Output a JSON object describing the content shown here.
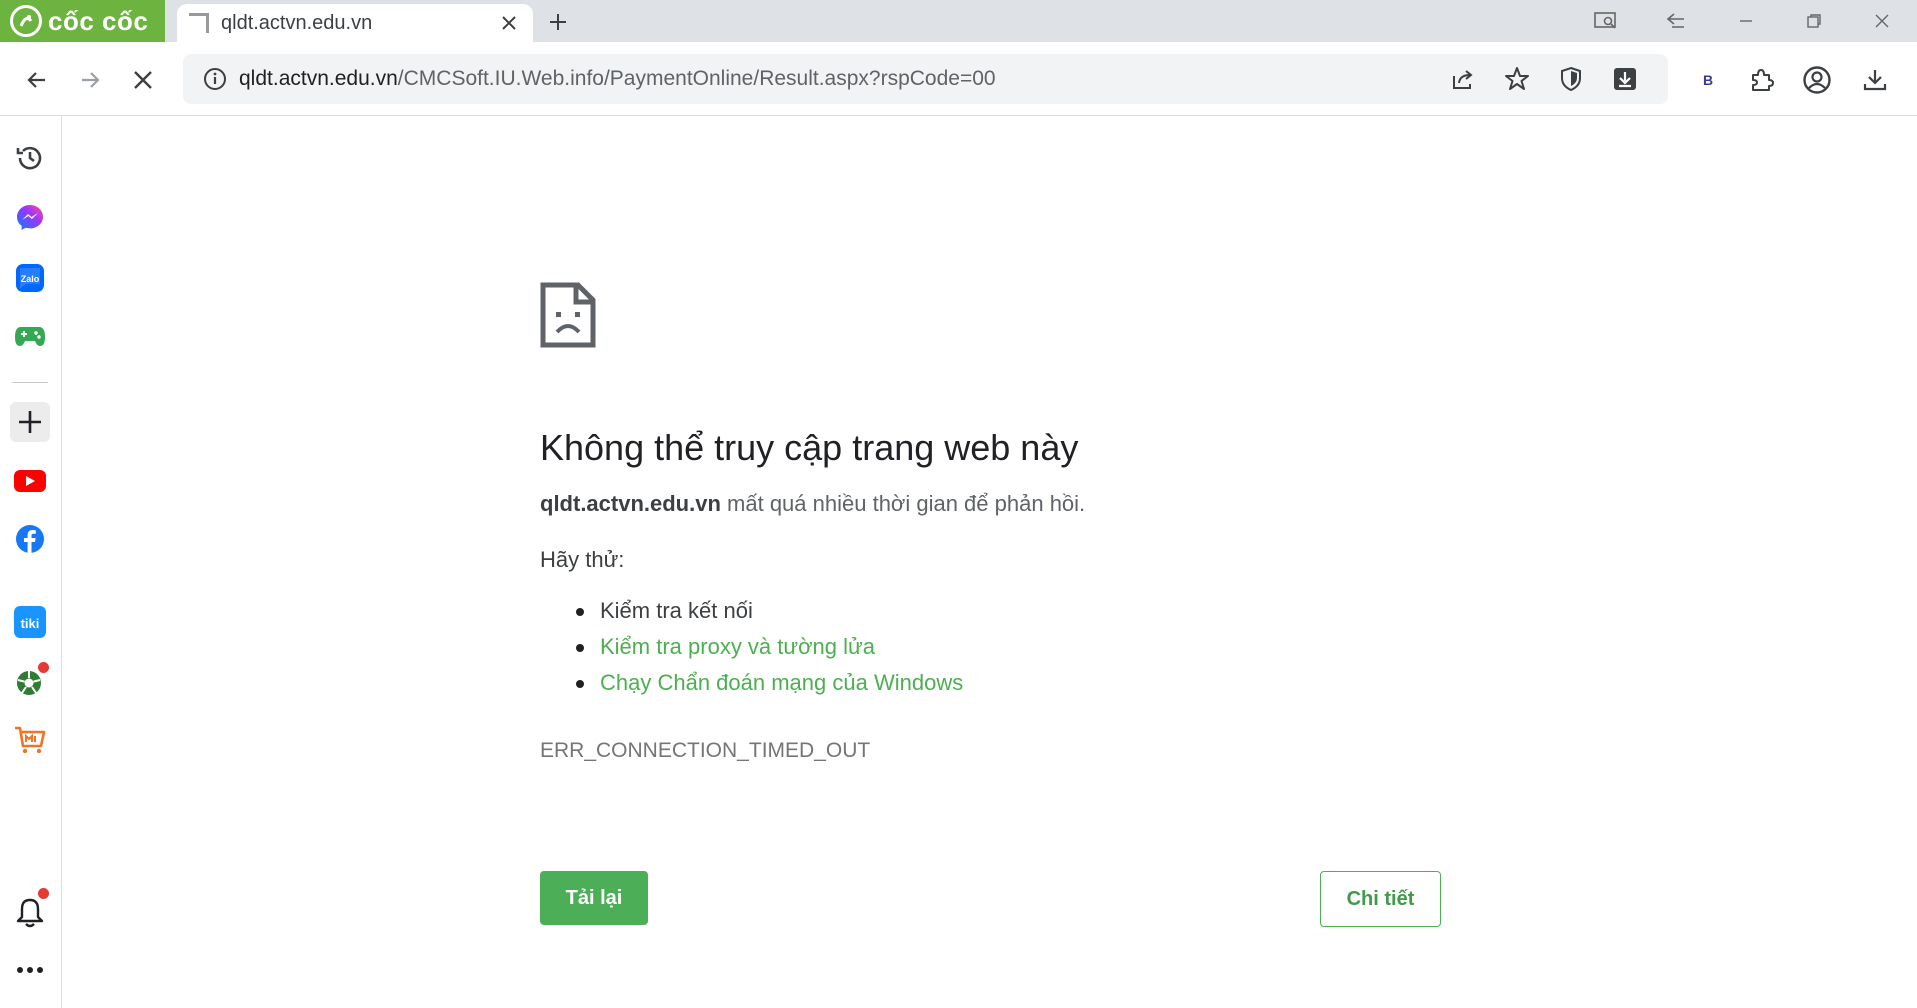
{
  "brand": {
    "name": "cốc cốc",
    "color": "#6db33f"
  },
  "tab": {
    "title": "qldt.actvn.edu.vn"
  },
  "address_bar": {
    "host": "qldt.actvn.edu.vn",
    "path": "/CMCSoft.IU.Web.info/PaymentOnline/Result.aspx?rspCode=00"
  },
  "toolbar": {
    "icons": [
      "back-icon",
      "forward-icon",
      "stop-icon",
      "info-icon",
      "share-icon",
      "star-icon",
      "shield-icon",
      "download-arrow-icon",
      "extension-b",
      "puzzle-icon",
      "profile-icon",
      "downloads-icon"
    ],
    "extension_letter": "B"
  },
  "window_controls": [
    "screen-capture-icon",
    "back-history-icon",
    "minimize-icon",
    "restore-icon",
    "close-icon"
  ],
  "sidebar": {
    "items": [
      "history-icon",
      "messenger-icon",
      "zalo-icon",
      "games-icon",
      "add-icon",
      "youtube-icon",
      "facebook-icon",
      "tiki-icon",
      "football-icon",
      "shopping-icon",
      "bell-icon",
      "more-icon"
    ],
    "zalo_label": "Zalo",
    "tiki_label": "tiki"
  },
  "error": {
    "title": "Không thể truy cập trang web này",
    "host": "qldt.actvn.edu.vn",
    "message": " mất quá nhiều thời gian để phản hồi.",
    "try_label": "Hãy thử:",
    "suggestions": [
      {
        "text": "Kiểm tra kết nối",
        "is_link": false
      },
      {
        "text": "Kiểm tra proxy và tường lửa",
        "is_link": true
      },
      {
        "text": "Chạy Chẩn đoán mạng của Windows",
        "is_link": true
      }
    ],
    "code": "ERR_CONNECTION_TIMED_OUT",
    "reload_label": "Tải lại",
    "details_label": "Chi tiết"
  },
  "colors": {
    "accent_green": "#4caf58",
    "link_green": "#4caf50"
  }
}
